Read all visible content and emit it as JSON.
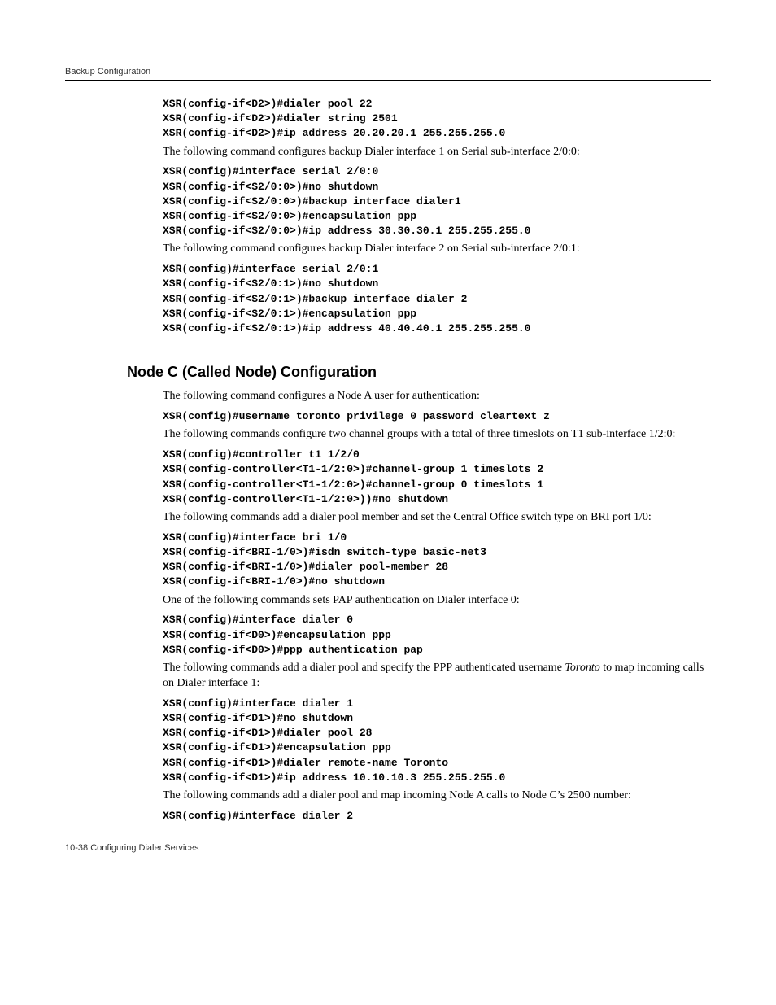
{
  "header": "Backup Configuration",
  "b1": {
    "l1": "XSR(config-if<D2>)#dialer pool 22",
    "l2": "XSR(config-if<D2>)#dialer string 2501",
    "l3": "XSR(config-if<D2>)#ip address 20.20.20.1 255.255.255.0"
  },
  "p1": "The following command configures backup Dialer interface 1 on Serial sub-interface 2/0:0:",
  "b2": {
    "l1": "XSR(config)#interface serial 2/0:0",
    "l2": "XSR(config-if<S2/0:0>)#no shutdown",
    "l3": "XSR(config-if<S2/0:0>)#backup interface dialer1",
    "l4": "XSR(config-if<S2/0:0>)#encapsulation ppp",
    "l5": "XSR(config-if<S2/0:0>)#ip address 30.30.30.1 255.255.255.0"
  },
  "p2": "The following command configures backup Dialer interface 2 on Serial sub-interface 2/0:1:",
  "b3": {
    "l1": "XSR(config)#interface serial 2/0:1",
    "l2": "XSR(config-if<S2/0:1>)#no shutdown",
    "l3": "XSR(config-if<S2/0:1>)#backup interface dialer 2",
    "l4": "XSR(config-if<S2/0:1>)#encapsulation ppp",
    "l5": "XSR(config-if<S2/0:1>)#ip address 40.40.40.1 255.255.255.0"
  },
  "heading": "Node C (Called Node) Configuration",
  "p3": "The following command configures a Node A user for authentication:",
  "b4": {
    "l1": "XSR(config)#username toronto privilege 0 password cleartext z"
  },
  "p4": "The following commands configure two channel groups with a total of three timeslots on T1 sub-interface 1/2:0:",
  "b5": {
    "l1": "XSR(config)#controller t1 1/2/0",
    "l2": "XSR(config-controller<T1-1/2:0>)#channel-group 1 timeslots 2",
    "l3": "XSR(config-controller<T1-1/2:0>)#channel-group 0 timeslots 1",
    "l4": "XSR(config-controller<T1-1/2:0>))#no shutdown"
  },
  "p5": "The following commands add a dialer pool member and set the Central Office switch type on BRI port 1/0:",
  "b6": {
    "l1": "XSR(config)#interface bri 1/0",
    "l2": "XSR(config-if<BRI-1/0>)#isdn switch-type basic-net3",
    "l3": "XSR(config-if<BRI-1/0>)#dialer pool-member 28",
    "l4": "XSR(config-if<BRI-1/0>)#no shutdown"
  },
  "p6": "One of the following commands sets PAP authentication on Dialer interface 0:",
  "b7": {
    "l1": "XSR(config)#interface dialer 0",
    "l2": "XSR(config-if<D0>)#encapsulation ppp",
    "l3": "XSR(config-if<D0>)#ppp authentication pap"
  },
  "p7a": "The following commands add a dialer pool and specify the PPP authenticated username ",
  "p7i": "Toronto",
  "p7b": " to map incoming calls on Dialer interface 1:",
  "b8": {
    "l1": "XSR(config)#interface dialer 1",
    "l2": "XSR(config-if<D1>)#no shutdown",
    "l3": "XSR(config-if<D1>)#dialer pool 28",
    "l4": "XSR(config-if<D1>)#encapsulation ppp",
    "l5": "XSR(config-if<D1>)#dialer remote-name Toronto",
    "l6": "XSR(config-if<D1>)#ip address 10.10.10.3 255.255.255.0"
  },
  "p8": "The following commands add a dialer pool and map incoming Node A calls to Node C’s 2500 number:",
  "b9": {
    "l1": "XSR(config)#interface dialer 2"
  },
  "footer": "10-38   Configuring Dialer Services"
}
